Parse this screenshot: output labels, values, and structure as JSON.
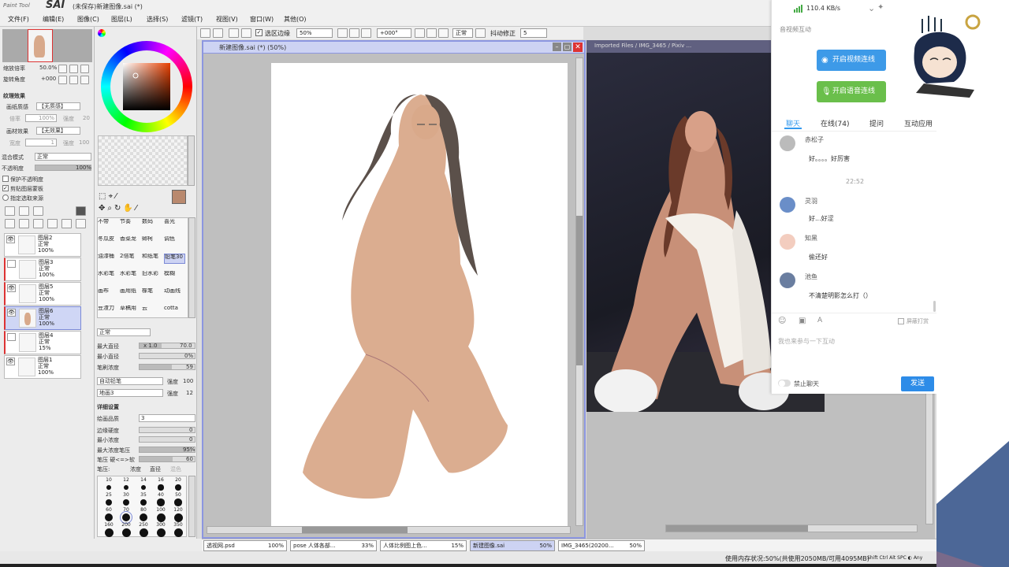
{
  "app": {
    "logo_sub": "Paint Tool",
    "logo_main": "SAI",
    "title": "(未保存)新建图像.sai (*)"
  },
  "menu": [
    "文件(F)",
    "编辑(E)",
    "图像(C)",
    "图层(L)",
    "选择(S)",
    "滤镜(T)",
    "视图(V)",
    "窗口(W)",
    "其他(O)"
  ],
  "toolbar": {
    "selection_edge_label": "选区边缘",
    "zoom": "50%",
    "rotation": "+000°",
    "mode": "正常",
    "stabilizer_label": "抖动修正",
    "stabilizer": "5"
  },
  "navigator": {
    "zoom_label": "缩放倍率",
    "zoom_value": "50.0%",
    "rotate_label": "旋转角度",
    "rotate_value": "+000"
  },
  "effects": {
    "header": "纹理效果",
    "paper_label": "画纸质感",
    "paper_value": "【无质感】",
    "scale_label": "倍率",
    "scale_value": "100%",
    "strength_label": "强度",
    "strength_value": "20",
    "effect_label": "画材效果",
    "effect_value": "【无效果】",
    "width_label": "宽度",
    "width_value": "1",
    "intensity_label": "强度",
    "intensity_value": "100",
    "blend_label": "混合模式",
    "blend_value": "正常",
    "opacity_label": "不透明度",
    "opacity_value": "100%",
    "check_protect": "保护不透明度",
    "check_clip": "剪贴图层蒙板",
    "check_source": "指定选取来源"
  },
  "layers": [
    {
      "name": "图层2",
      "mode": "正常",
      "opacity": "100%",
      "visible": true
    },
    {
      "name": "图层3",
      "mode": "正常",
      "opacity": "100%",
      "visible": false
    },
    {
      "name": "图层5",
      "mode": "正常",
      "opacity": "100%",
      "visible": true
    },
    {
      "name": "图层6",
      "mode": "正常",
      "opacity": "100%",
      "visible": true,
      "selected": true
    },
    {
      "name": "图层4",
      "mode": "正常",
      "opacity": "15%",
      "visible": false
    },
    {
      "name": "图层1",
      "mode": "正常",
      "opacity": "100%",
      "visible": true
    }
  ],
  "brushes": [
    [
      "不带",
      "节奏",
      "数码",
      "喜光"
    ],
    [
      "冬瓜皮",
      "香菜龙",
      "卿柯",
      "调色"
    ],
    [
      "油漆桶",
      "2倍笔",
      "和纸笔",
      "铅笔30"
    ],
    [
      "水彩笔",
      "水彩笔",
      "旧水彩",
      "模糊"
    ],
    [
      "画布",
      "画用纸",
      "橡笔",
      "动画线"
    ],
    [
      "豆渣刀",
      "草稿用",
      "云",
      "cotta"
    ]
  ],
  "brush_settings": {
    "mode": "正常",
    "max_size_label": "最大直径",
    "max_size_mult": "x 1.0",
    "max_size": "70.0",
    "min_size_label": "最小直径",
    "min_size": "0%",
    "density_label": "笔刷浓度",
    "density": "59",
    "shape": "自动铅笔",
    "shape_strength_label": "强度",
    "shape_strength": "100",
    "texture": "地画3",
    "texture_strength_label": "强度",
    "texture_strength": "12",
    "detail_header": "详细设置",
    "quality_label": "绘画品质",
    "quality": "3",
    "edge_label": "边缘硬度",
    "edge": "0",
    "min_density_label": "最小浓度",
    "min_density": "0",
    "max_pressure_label": "最大浓度笔压",
    "max_pressure": "95%",
    "pressure_label": "笔压 硬<=>软",
    "pressure": "60",
    "pressure2_label": "笔压:",
    "pressure_density": "浓度",
    "pressure_size": "直径",
    "pressure_blend": "混色"
  },
  "size_presets": [
    [
      "10",
      "12",
      "14",
      "16",
      "20"
    ],
    [
      "25",
      "30",
      "35",
      "40",
      "50"
    ],
    [
      "60",
      "70",
      "80",
      "100",
      "120"
    ],
    [
      "160",
      "200",
      "250",
      "300",
      "350"
    ]
  ],
  "canvas": {
    "title": "新建图像.sai (*) (50%)"
  },
  "reference": {
    "title": "Imported Files / IMG_3465 / Pixiv ..."
  },
  "doc_tabs": [
    {
      "name": "透视网.psd",
      "zoom": "100%"
    },
    {
      "name": "pose 人体各部...",
      "zoom": "33%"
    },
    {
      "name": "人体比例图上色...",
      "zoom": "15%"
    },
    {
      "name": "新建图像.sai",
      "zoom": "50%",
      "selected": true
    },
    {
      "name": "IMG_3465(20200...",
      "zoom": "50%"
    }
  ],
  "status": {
    "memory": "使用内存状况:50%(共使用2050MB/可用4095MB)",
    "keys": "Shift Ctrl Alt SPC ◐ Any"
  },
  "chat": {
    "speed": "110.4 KB/s",
    "section_label": "音视频互动",
    "video_btn": "开启视频连线",
    "voice_btn": "开启语音连线",
    "tabs": [
      "聊天",
      "在线(74)",
      "提问",
      "互动应用"
    ],
    "messages": [
      {
        "name": "赤松子",
        "text": "好。。。。好厉害"
      },
      {
        "time": "22:52"
      },
      {
        "name": "灵羽",
        "text": "好...好涩"
      },
      {
        "name": "知黑",
        "text": "偷还好"
      },
      {
        "name": "池鱼",
        "text": "不清楚明影怎么打（）"
      }
    ],
    "block_label": "屏蔽打赏",
    "input_placeholder": "我也来参与一下互动",
    "mute_label": "禁止聊天",
    "send_label": "发送",
    "colors": {
      "video": "#3d9ae8",
      "voice": "#6abf4b",
      "send": "#2d8ce8",
      "accent": "#3399ee"
    }
  }
}
